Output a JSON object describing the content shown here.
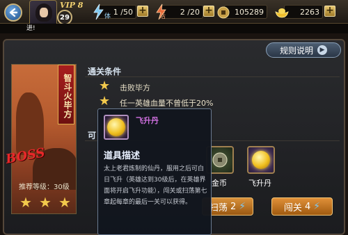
{
  "topbar": {
    "vip_label": "VIP 8",
    "player_level": "29",
    "stamina_icon_char": "体",
    "stamina": "1 /50",
    "energy_icon_char": "活",
    "energy": "2 /20",
    "coins": "105289",
    "gold": "2263"
  },
  "ticker": {
    "text": "进!"
  },
  "rules_button": {
    "label": "规则说明"
  },
  "stage": {
    "name": "智斗火毕方",
    "boss_label": "BOSS",
    "recommended_label": "推荐等级：",
    "recommended_level": "30级",
    "stars_earned": 3
  },
  "conditions": {
    "title": "通关条件",
    "items": [
      "击败毕方",
      "任一英雄血量不曾低于20%"
    ]
  },
  "rewards": {
    "title_partial": "可",
    "coin_label_partial": "金币",
    "item_label": "飞升丹"
  },
  "buttons": {
    "sweep_label": "扫荡",
    "sweep_cost": "2",
    "challenge_label": "闯关",
    "challenge_cost": "4"
  },
  "tooltip": {
    "item_name": "飞升丹",
    "header": "道具描述",
    "description": "太上老君炼制的仙丹，服用之后可白日飞升（英雄达到30级后，在英雄界面将开启飞升功能），闯关或扫荡第七章起每章的最后一关可以获得。"
  },
  "colors": {
    "accent_gold": "#f2c94c",
    "boss_red": "#e8282a",
    "tooltip_name": "#d070e0",
    "button_orange": "#d8903a"
  }
}
